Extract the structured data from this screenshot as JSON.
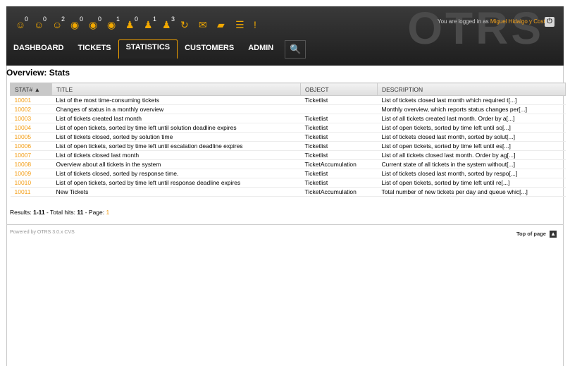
{
  "header": {
    "logo_text": "OTRS",
    "login_prefix": "You are logged in as",
    "user_name": "Miguel Hidalgo y Costilla",
    "toolbar": [
      {
        "icon": "person-icon",
        "glyph": "☺",
        "count": "0"
      },
      {
        "icon": "person-icon",
        "glyph": "☺",
        "count": "0"
      },
      {
        "icon": "person-icon",
        "glyph": "☺",
        "count": "2"
      },
      {
        "icon": "eye-icon",
        "glyph": "◉",
        "count": "0"
      },
      {
        "icon": "eye-icon",
        "glyph": "◉",
        "count": "0"
      },
      {
        "icon": "eye-icon",
        "glyph": "◉",
        "count": "1"
      },
      {
        "icon": "user-icon",
        "glyph": "♟",
        "count": "0"
      },
      {
        "icon": "user-icon",
        "glyph": "♟",
        "count": "1"
      },
      {
        "icon": "user-icon",
        "glyph": "♟",
        "count": "3"
      },
      {
        "icon": "refresh-icon",
        "glyph": "↻",
        "count": ""
      },
      {
        "icon": "mail-icon",
        "glyph": "✉",
        "count": ""
      },
      {
        "icon": "folder-icon",
        "glyph": "▰",
        "count": ""
      },
      {
        "icon": "list-icon",
        "glyph": "☰",
        "count": ""
      },
      {
        "icon": "alert-icon",
        "glyph": "!",
        "count": ""
      }
    ],
    "logout_glyph": "⏻"
  },
  "nav": {
    "items": [
      "DASHBOARD",
      "TICKETS",
      "STATISTICS",
      "CUSTOMERS",
      "ADMIN"
    ],
    "active": "STATISTICS",
    "search_glyph": "🔍"
  },
  "page": {
    "title": "Overview: Stats"
  },
  "table": {
    "headers": [
      "STAT#",
      "TITLE",
      "OBJECT",
      "DESCRIPTION"
    ],
    "sort_glyph": "▲",
    "rows": [
      [
        "10001",
        "List of the most time-consuming tickets",
        "Ticketlist",
        "List of tickets closed last month which required t[...]"
      ],
      [
        "10002",
        "Changes of status in a monthly overview",
        "",
        "Monthly overview, which reports status changes per[...]"
      ],
      [
        "10003",
        "List of tickets created last month",
        "Ticketlist",
        "List of all tickets created last month. Order by a[...]"
      ],
      [
        "10004",
        "List of open tickets, sorted by time left until solution deadline expires",
        "Ticketlist",
        "List of open tickets, sorted by time left until so[...]"
      ],
      [
        "10005",
        "List of tickets closed, sorted by solution time",
        "Ticketlist",
        "List of tickets closed last month, sorted by solut[...]"
      ],
      [
        "10006",
        "List of open tickets, sorted by time left until escalation deadline expires",
        "Ticketlist",
        "List of open tickets, sorted by time left until es[...]"
      ],
      [
        "10007",
        "List of tickets closed last month",
        "Ticketlist",
        "List of all tickets closed last month. Order by ag[...]"
      ],
      [
        "10008",
        "Overview about all tickets in the system",
        "TicketAccumulation",
        "Current state of all tickets in the system without[...]"
      ],
      [
        "10009",
        "List of tickets closed, sorted by response time.",
        "Ticketlist",
        "List of tickets closed last month, sorted by respo[...]"
      ],
      [
        "10010",
        "List of open tickets, sorted by time left until response deadline expires",
        "Ticketlist",
        "List of open tickets, sorted by time left until re[...]"
      ],
      [
        "10011",
        "New Tickets",
        "TicketAccumulation",
        "Total number of new tickets per day and queue whic[...]"
      ]
    ]
  },
  "results": {
    "label": "Results:",
    "range": "1-11",
    "hits_label": "- Total hits:",
    "hits": "11",
    "page_label": "- Page:",
    "page": "1"
  },
  "footer": {
    "powered": "Powered by OTRS 3.0.x CVS",
    "top_of_page": "Top of page",
    "top_glyph": "▲"
  },
  "colors": {
    "accent": "#f39c12",
    "header_bg": "#2b2b2b"
  }
}
